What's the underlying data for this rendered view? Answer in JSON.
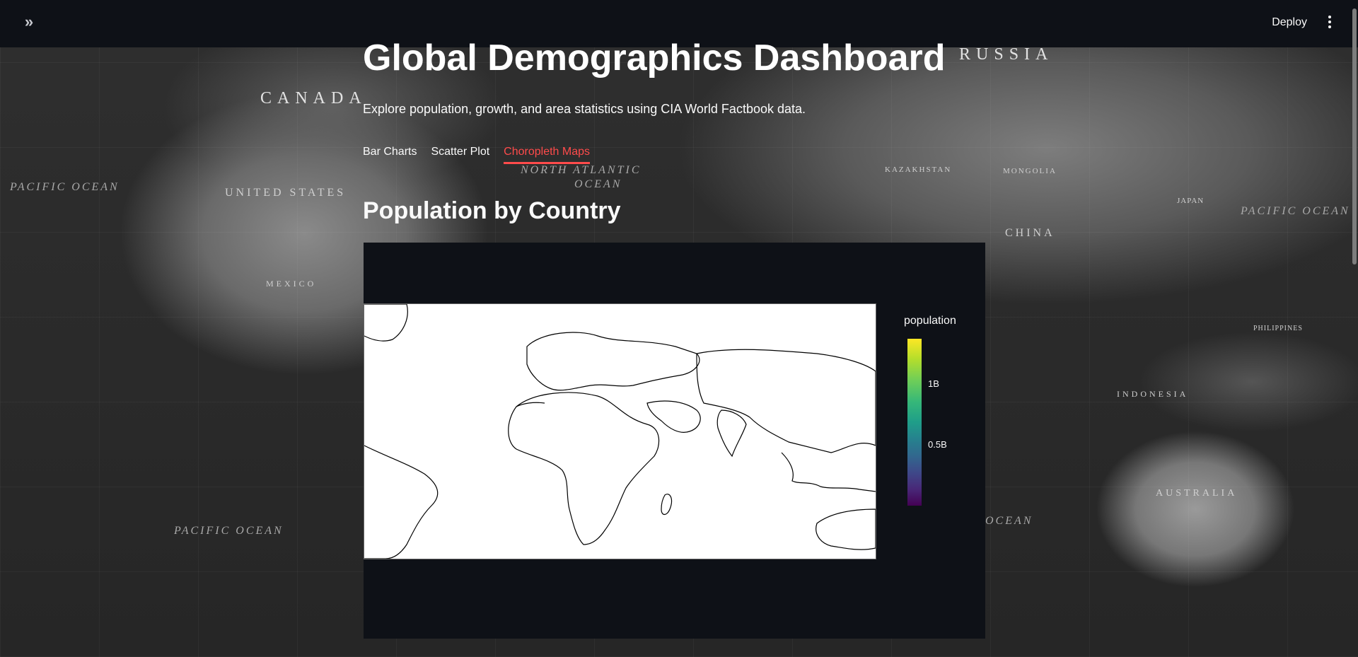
{
  "header": {
    "sidebar_toggle_glyph": "»",
    "deploy_label": "Deploy"
  },
  "background": {
    "labels": {
      "canada": "CANADA",
      "russia": "RUSSIA",
      "united_states": "UNITED STATES",
      "china": "CHINA",
      "australia": "AUSTRALIA",
      "indonesia": "INDONESIA",
      "mexico": "MEXICO",
      "mongolia": "MONGOLIA",
      "kazakhstan": "KAZAKHSTAN",
      "japan": "JAPAN",
      "philippines": "PHILIPPINES",
      "pacific_ocean_1": "PACIFIC OCEAN",
      "pacific_ocean_2": "PACIFIC OCEAN",
      "pacific_ocean_3": "PACIFIC OCEAN",
      "north_atlantic": "NORTH ATLANTIC",
      "ocean": "OCEAN",
      "ocean_2": "OCEAN"
    }
  },
  "main": {
    "title": "Global Demographics Dashboard",
    "subtitle": "Explore population, growth, and area statistics using CIA World Factbook data.",
    "tabs": [
      {
        "label": "Bar Charts",
        "active": false
      },
      {
        "label": "Scatter Plot",
        "active": false
      },
      {
        "label": "Choropleth Maps",
        "active": true
      }
    ],
    "section_title": "Population by Country"
  },
  "chart_data": {
    "type": "choropleth",
    "title": "",
    "colorbar_title": "population",
    "colorscale": [
      "#440154",
      "#3e4989",
      "#26828e",
      "#35b779",
      "#b5de2b",
      "#fde725"
    ],
    "ticks": [
      {
        "label": "1B",
        "value": 1000000000
      },
      {
        "label": "0.5B",
        "value": 500000000
      }
    ],
    "range": [
      0,
      1400000000
    ],
    "map_fill": "#ffffff",
    "map_outline": "#000000"
  },
  "colors": {
    "accent": "#ff4b4b",
    "header_bg": "#0e1117",
    "text": "#fafafa"
  }
}
